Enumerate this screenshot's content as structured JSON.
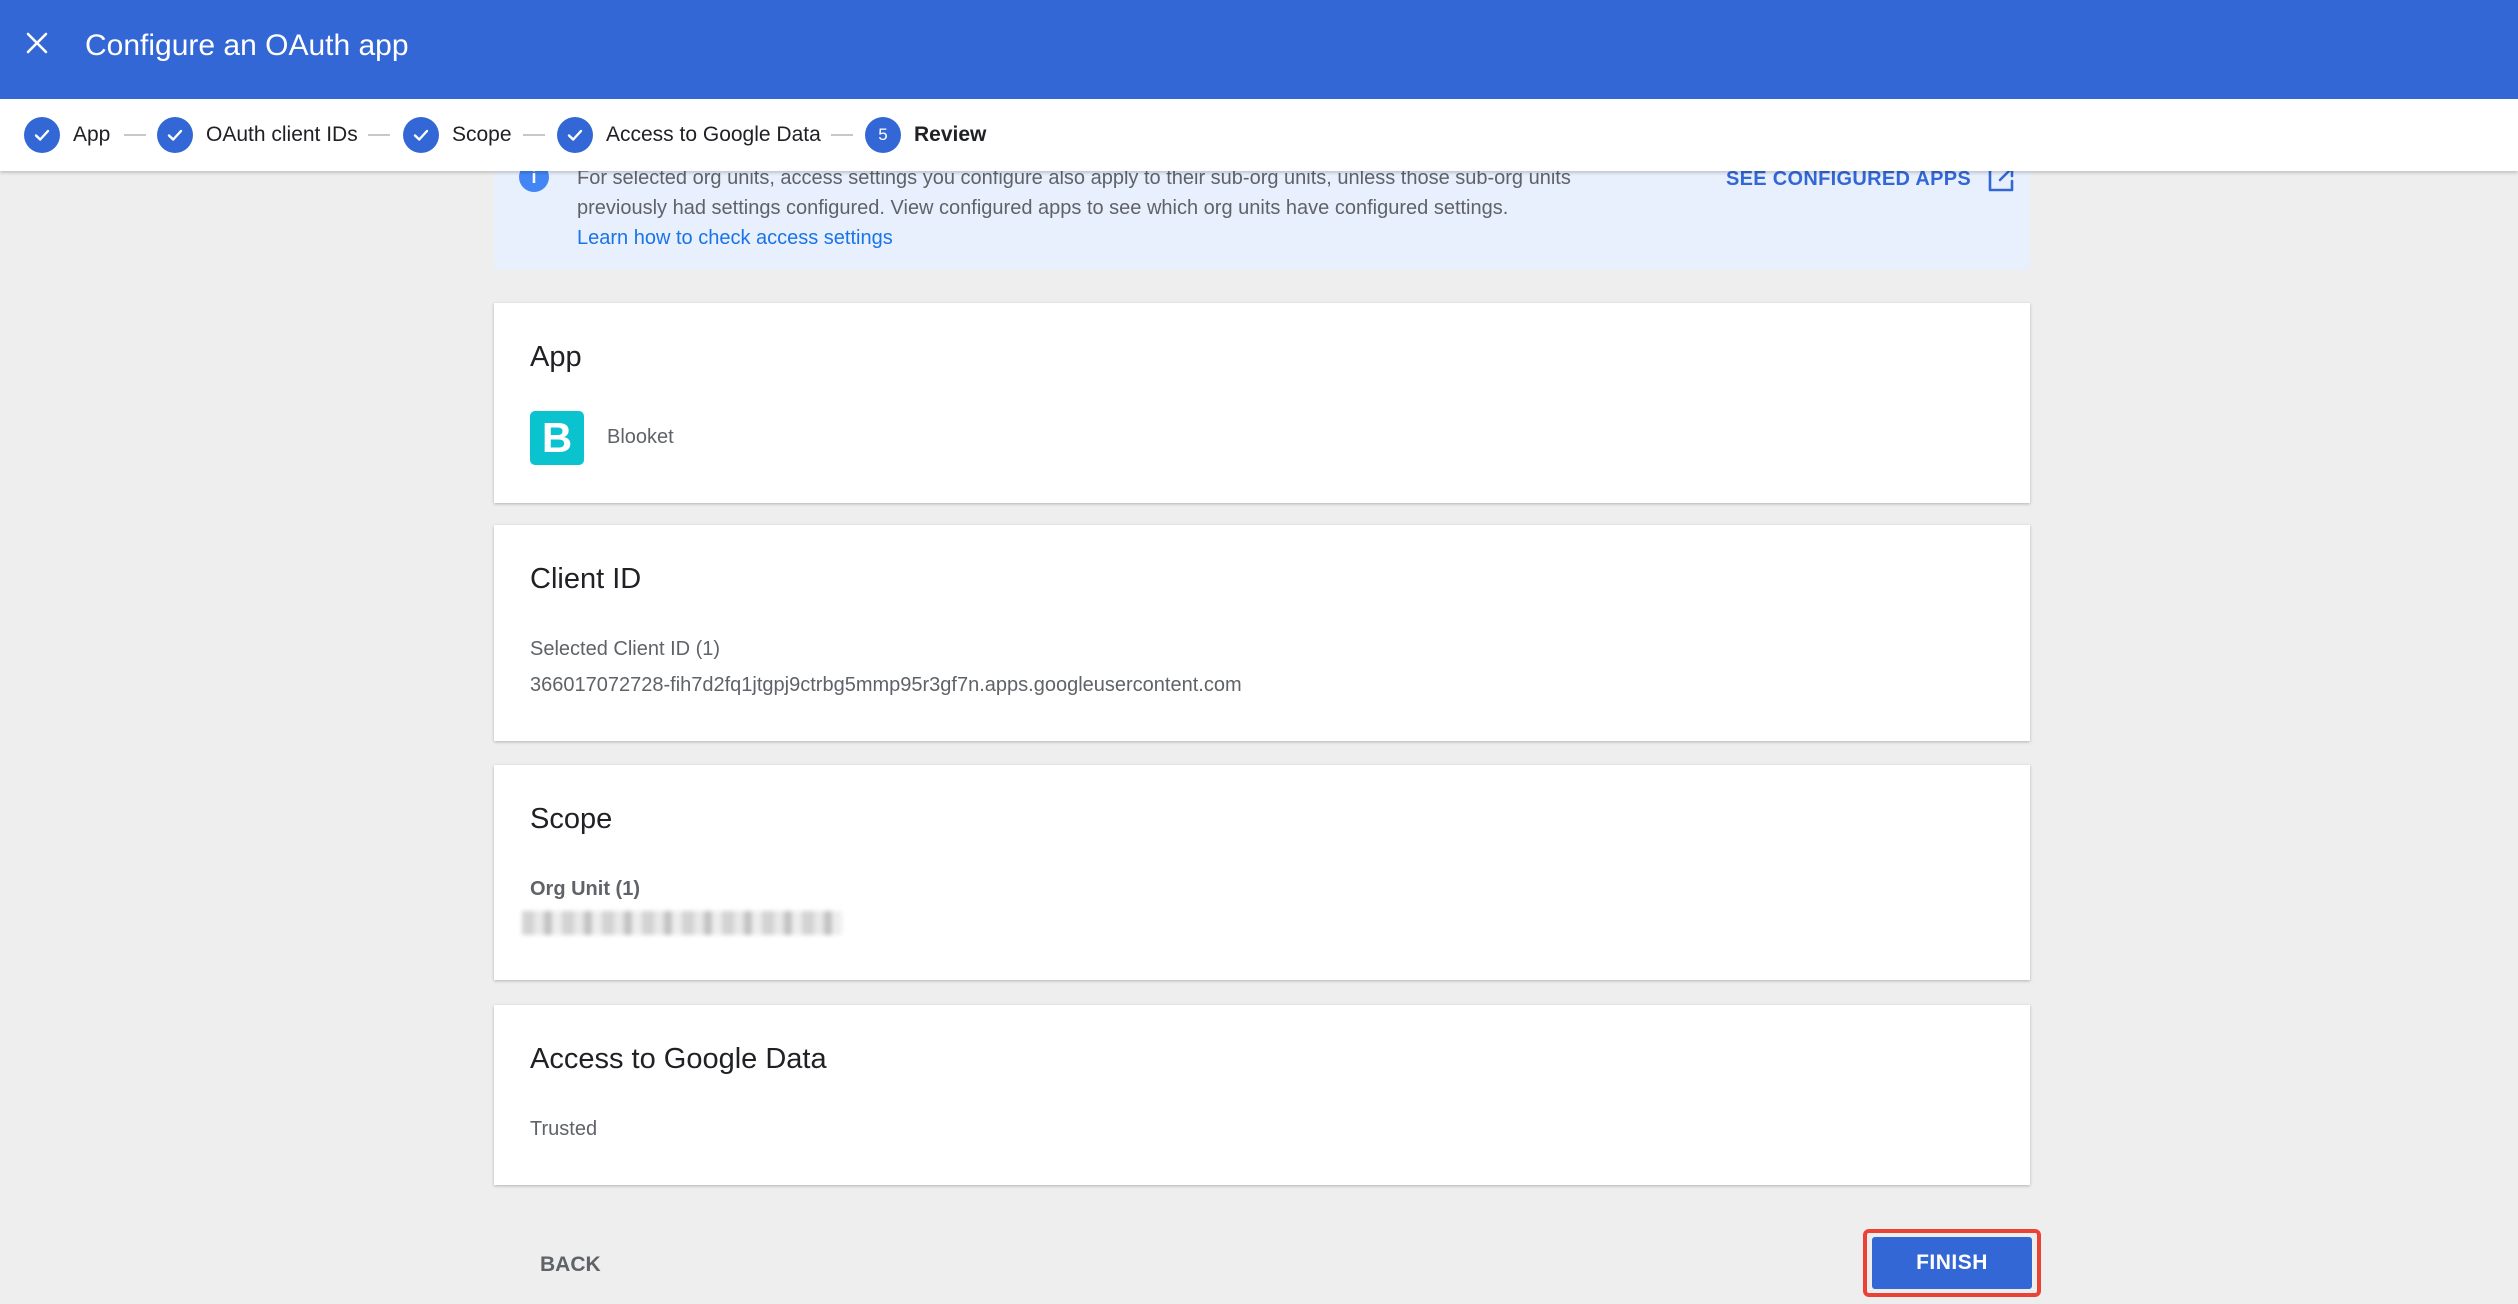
{
  "header": {
    "title": "Configure an OAuth app",
    "close_icon": "close-icon"
  },
  "stepper": {
    "steps": [
      {
        "label": "App",
        "state": "done"
      },
      {
        "label": "OAuth client IDs",
        "state": "done"
      },
      {
        "label": "Scope",
        "state": "done"
      },
      {
        "label": "Access to Google Data",
        "state": "done"
      },
      {
        "label": "Review",
        "state": "active",
        "number": "5"
      }
    ]
  },
  "info": {
    "text": "For selected org units, access settings you configure also apply to their sub-org units, unless those sub-org units previously had settings configured. View configured apps to see which org units have configured settings.",
    "link": "Learn how to check access settings",
    "action": "SEE CONFIGURED APPS"
  },
  "app_card": {
    "title": "App",
    "app_name": "Blooket",
    "logo_letter": "B"
  },
  "client_card": {
    "title": "Client ID",
    "label": "Selected Client ID (1)",
    "value": "366017072728-fih7d2fq1jtgpj9ctrbg5mmp95r3gf7n.apps.googleusercontent.com"
  },
  "scope_card": {
    "title": "Scope",
    "label": "Org Unit (1)"
  },
  "access_card": {
    "title": "Access to Google Data",
    "value": "Trusted"
  },
  "footer": {
    "back_label": "BACK",
    "finish_label": "FINISH"
  },
  "colors": {
    "primary": "#3367d6",
    "highlight": "#ea4335",
    "banner": "#e8f0fe",
    "app_logo": "#0bc2cf"
  }
}
